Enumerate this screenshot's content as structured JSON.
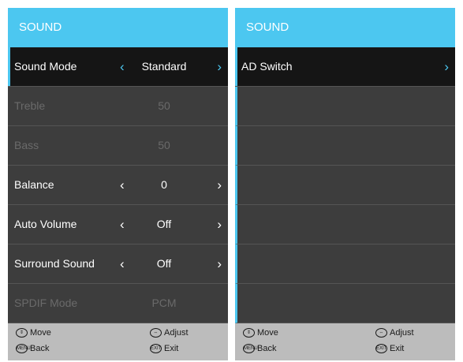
{
  "left_panel": {
    "title": "SOUND",
    "items": [
      {
        "label": "Sound Mode",
        "value": "Standard"
      },
      {
        "label": "Treble",
        "value": "50"
      },
      {
        "label": "Bass",
        "value": "50"
      },
      {
        "label": "Balance",
        "value": "0"
      },
      {
        "label": "Auto Volume",
        "value": "Off"
      },
      {
        "label": "Surround Sound",
        "value": "Off"
      },
      {
        "label": "SPDIF Mode",
        "value": "PCM"
      }
    ]
  },
  "right_panel": {
    "title": "SOUND",
    "items": [
      {
        "label": "AD Switch"
      }
    ]
  },
  "footer": {
    "move": "Move",
    "adjust": "Adjust",
    "back": "Back",
    "exit": "Exit"
  },
  "icons": {
    "left_arrow": "‹",
    "right_arrow": "›"
  },
  "colors": {
    "accent": "#4cc7f0",
    "panel": "#3d3d3d",
    "selected": "#151515",
    "footer": "#bcbcbc"
  }
}
